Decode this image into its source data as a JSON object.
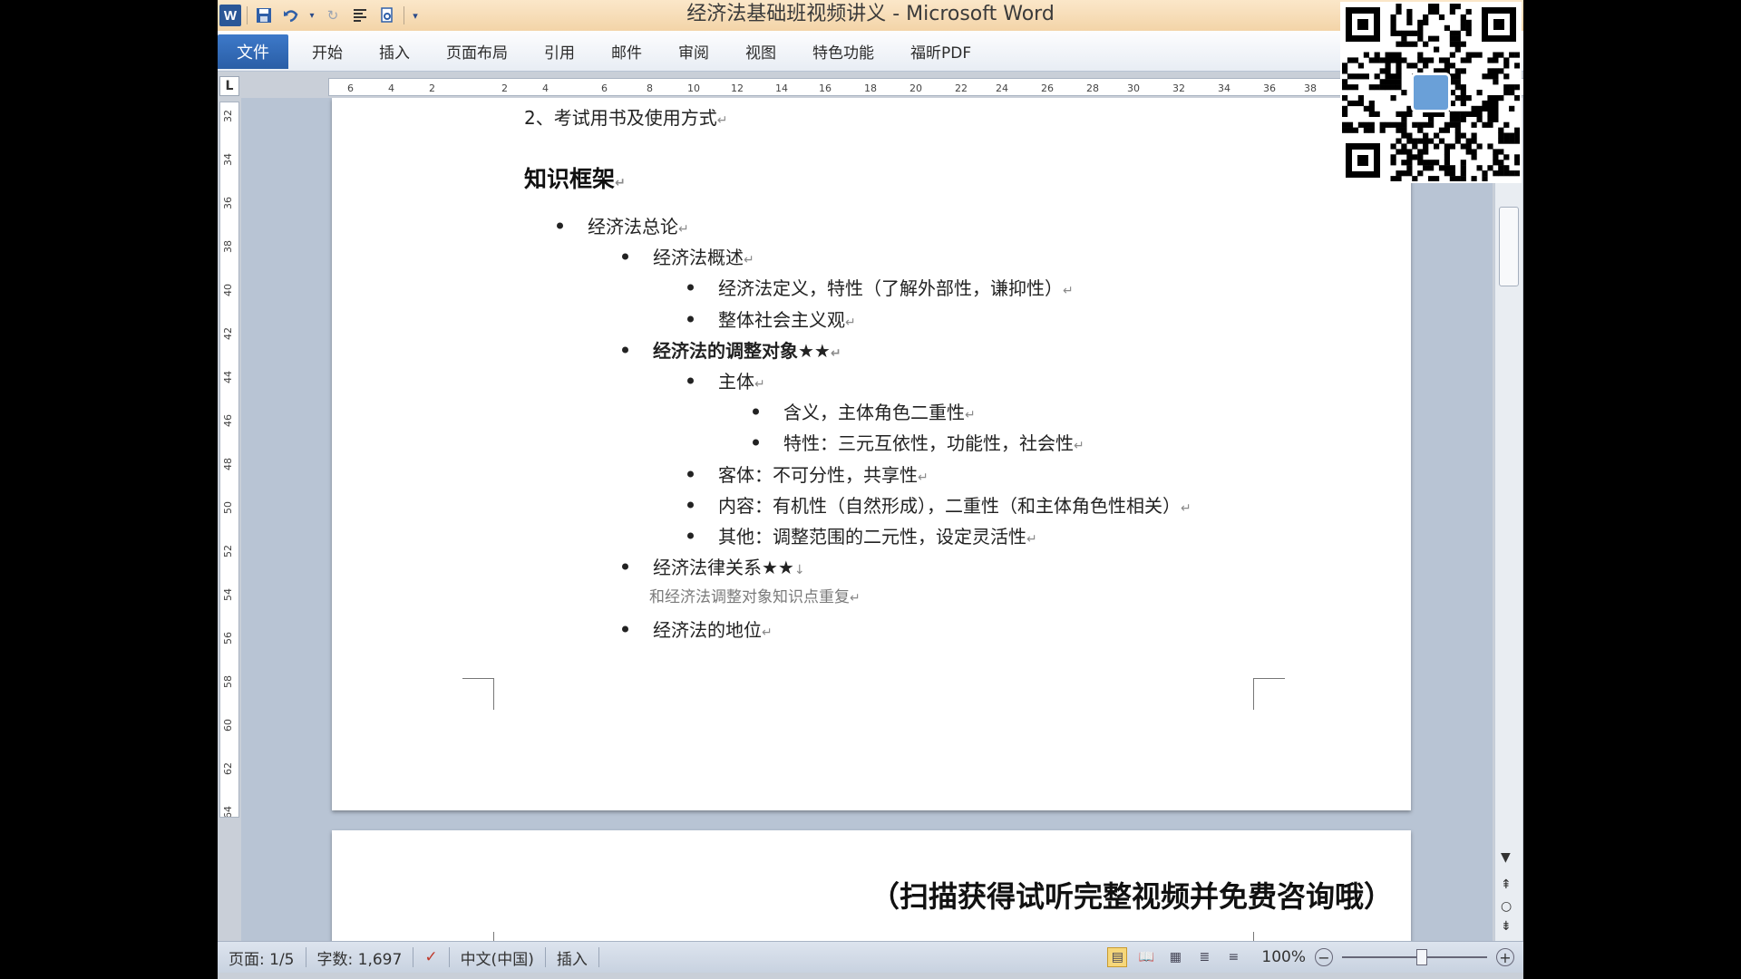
{
  "window": {
    "title": "经济法基础班视频讲义 - Microsoft Word"
  },
  "qat": {
    "app_icon": "W",
    "icons": [
      "save-icon",
      "undo-icon",
      "undo-dropdown-icon",
      "redo-icon",
      "format-icon",
      "print-preview-icon",
      "customize-qat-icon"
    ]
  },
  "ribbon": {
    "file_tab": "文件",
    "tabs": [
      "开始",
      "插入",
      "页面布局",
      "引用",
      "邮件",
      "审阅",
      "视图",
      "特色功能",
      "福昕PDF"
    ]
  },
  "ruler": {
    "corner": "L",
    "h_ticks": [
      "6",
      "4",
      "2",
      "2",
      "4",
      "6",
      "8",
      "10",
      "12",
      "14",
      "16",
      "18",
      "20",
      "22",
      "24",
      "26",
      "28",
      "30",
      "32",
      "34",
      "36",
      "38"
    ],
    "v_ticks": [
      "32",
      "34",
      "36",
      "38",
      "40",
      "42",
      "44",
      "46",
      "48",
      "50",
      "52",
      "54",
      "56",
      "58",
      "60",
      "62",
      "64"
    ]
  },
  "document": {
    "intro_line": "2、考试用书及使用方式",
    "heading": "知识框架",
    "items": [
      {
        "text": "经济法总论",
        "level": 1,
        "bold": false
      },
      {
        "text": "经济法概述",
        "level": 2,
        "bold": false
      },
      {
        "text": "经济法定义，特性（了解外部性，谦抑性）",
        "level": 3,
        "bold": false
      },
      {
        "text": "整体社会主义观",
        "level": 3,
        "bold": false
      },
      {
        "text": "经济法的调整对象★★",
        "level": 2,
        "bold": true
      },
      {
        "text": "主体",
        "level": 3,
        "bold": false
      },
      {
        "text": "含义，主体角色二重性",
        "level": 4,
        "bold": false
      },
      {
        "text": "特性：三元互依性，功能性，社会性",
        "level": 4,
        "bold": false
      },
      {
        "text": "客体：不可分性，共享性",
        "level": 3,
        "bold": false
      },
      {
        "text": "内容：有机性（自然形成），二重性（和主体角色性相关）",
        "level": 3,
        "bold": false
      },
      {
        "text": "其他：调整范围的二元性，设定灵活性",
        "level": 3,
        "bold": false
      },
      {
        "text": "经济法律关系★★",
        "level": 2,
        "bold": false
      },
      {
        "text": "和经济法调整对象知识点重复",
        "level": 0,
        "bold": false
      },
      {
        "text": "经济法的地位",
        "level": 2,
        "bold": false
      }
    ],
    "paragraph_mark": "↵",
    "line_break_mark": "↓",
    "promo_text": "（扫描获得试听完整视频并免费咨询哦）"
  },
  "statusbar": {
    "page": "页面: 1/5",
    "words": "字数: 1,697",
    "language": "中文(中国)",
    "mode": "插入",
    "zoom": "100%",
    "zoom_minus": "−",
    "zoom_plus": "+"
  }
}
